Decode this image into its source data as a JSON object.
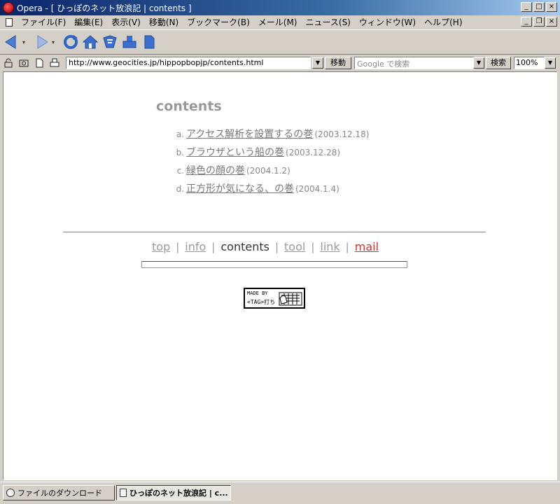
{
  "window": {
    "title": "Opera - [ ひっぽのネット放浪記 | contents ]",
    "buttons": {
      "minimize": "_",
      "maximize": "□",
      "close": "×",
      "restore": "❐"
    }
  },
  "menu": {
    "items": [
      "ファイル(F)",
      "編集(E)",
      "表示(V)",
      "移動(N)",
      "ブックマーク(B)",
      "メール(M)",
      "ニュース(S)",
      "ウィンドウ(W)",
      "ヘルプ(H)"
    ]
  },
  "toolbar": {
    "icons": [
      "back-icon",
      "forward-icon",
      "reload-icon",
      "home-icon",
      "hotlist-icon",
      "print-icon",
      "page-icon"
    ]
  },
  "address": {
    "url": "http://www.geocities.jp/hippopbopjp/contents.html",
    "go_label": "移動",
    "search_placeholder": "Google で検索",
    "search_label": "検索",
    "zoom": "100%"
  },
  "page": {
    "heading": "contents",
    "entries": [
      {
        "marker": "a.",
        "title": "アクセス解析を設置するの巻",
        "date": "(2003.12.18)"
      },
      {
        "marker": "b.",
        "title": "ブラウザという船の巻",
        "date": "(2003.12.28)"
      },
      {
        "marker": "c.",
        "title": "緑色の顔の巻",
        "date": "(2004.1.2)"
      },
      {
        "marker": "d.",
        "title": "正方形が気になる、の巻",
        "date": "(2004.1.4)"
      }
    ],
    "nav": {
      "top": "top",
      "info": "info",
      "contents": "contents",
      "tool": "tool",
      "link": "link",
      "mail": "mail",
      "separator": "|"
    },
    "badge": {
      "line1": "MADE BY",
      "line2": "<TAG>打ち"
    }
  },
  "taskbar": {
    "items": [
      {
        "label": "ファイルのダウンロード"
      },
      {
        "label": "ひっぽのネット放浪記 | c..."
      }
    ]
  }
}
